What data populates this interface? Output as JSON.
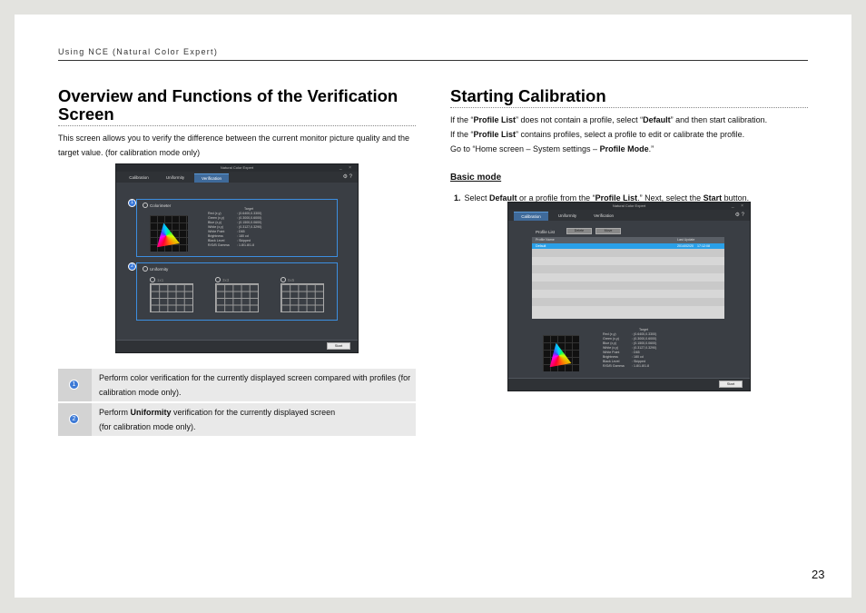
{
  "header": {
    "running_title": "Using NCE (Natural Color Expert)"
  },
  "page_number": "23",
  "left": {
    "title": "Overview and Functions of the Verification Screen",
    "intro": "This screen allows you to verify the difference between the current monitor picture quality and the target value. (for calibration mode only)",
    "screenshot": {
      "window_title": "Natural Color Expert",
      "tabs": [
        "Calibration",
        "Uniformity",
        "Verification"
      ],
      "active_tab": "Verification",
      "option_1": "Colorimeter",
      "option_2": "Uniformity",
      "badge_1": "1",
      "badge_2": "2",
      "target_label": "Target",
      "specs": [
        [
          "Red (x,y)",
          ": (0.6400,0.3300)"
        ],
        [
          "Green (x,y)",
          ": (0.3000,0.6000)"
        ],
        [
          "Blue (x,y)",
          ": (0.1500,0.0600)"
        ],
        [
          "White (x,y)",
          ": (0.3127,0.3290)"
        ],
        [
          "White Point",
          ": D65"
        ],
        [
          "Brightness",
          ": 180 cd"
        ],
        [
          "Black Level",
          ": Skipped"
        ],
        [
          "R/G/B Gamma",
          ": 1.8/1.8/1.8"
        ]
      ],
      "grid_labels": [
        "1x1",
        "3x3",
        "5x5"
      ],
      "start_button": "Start"
    },
    "legend": [
      {
        "badge": "1",
        "text": "Perform color verification for the currently displayed screen compared with profiles (for calibration mode only)."
      },
      {
        "badge": "2",
        "text_before": "Perform ",
        "text_bold": "Uniformity",
        "text_after": " verification for the currently displayed screen",
        "text_line2": "(for calibration mode only)."
      }
    ]
  },
  "right": {
    "title": "Starting Calibration",
    "p1": {
      "a": "If the “",
      "b": "Profile List",
      "c": "” does not contain a profile, select “",
      "d": "Default",
      "e": "” and then start calibration."
    },
    "p2": {
      "a": "If the “",
      "b": "Profile List",
      "c": "” contains profiles, select a profile to edit or calibrate the profile."
    },
    "p3": {
      "a": "Go to “Home screen – System settings – ",
      "b": "Profile Mode",
      "c": ".”"
    },
    "subhead": "Basic mode",
    "step": {
      "num": "1.",
      "a": "Select ",
      "b": "Default",
      "c": " or a profile from the “",
      "d": "Profile List",
      "e": ".” Next, select the ",
      "f": "Start",
      "g": " button."
    },
    "screenshot": {
      "window_title": "Natural Color Expert",
      "tabs": [
        "Calibration",
        "Uniformity",
        "Verification"
      ],
      "active_tab": "Calibration",
      "profile_list_label": "Profile List",
      "btn_1": "Delete",
      "btn_2": "Move",
      "col_profile_name": "Profile Name",
      "col_last_update": "Last Update",
      "row_name": "Default",
      "row_date": "2014/02/20",
      "row_time": "17:12:08",
      "target_label": "Target",
      "specs": [
        [
          "Red (x,y)",
          ": (0.6400,0.3300)"
        ],
        [
          "Green (x,y)",
          ": (0.3000,0.6000)"
        ],
        [
          "Blue (x,y)",
          ": (0.1500,0.0600)"
        ],
        [
          "White (x,y)",
          ": (0.3127,0.3290)"
        ],
        [
          "White Point",
          ": D65"
        ],
        [
          "Brightness",
          ": 180 cd"
        ],
        [
          "Black Level",
          ": Skipped"
        ],
        [
          "R/G/B Gamma",
          ": 1.8/1.8/1.8"
        ]
      ],
      "start_button": "Start"
    }
  }
}
